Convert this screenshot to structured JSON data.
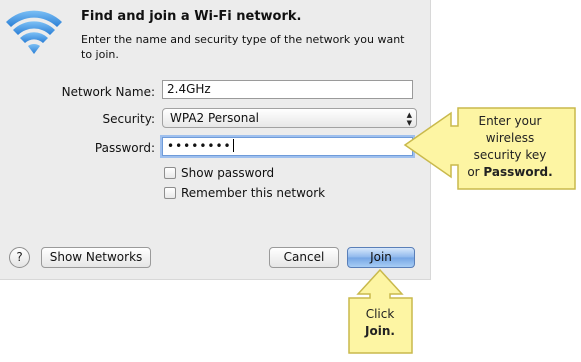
{
  "dialog": {
    "title": "Find and join a Wi-Fi network.",
    "subtitle": "Enter the name and security type of the network you want to join."
  },
  "form": {
    "network_name_label": "Network Name:",
    "network_name_value": "2.4GHz",
    "security_label": "Security:",
    "security_value": "WPA2 Personal",
    "password_label": "Password:",
    "password_masked": "••••••••"
  },
  "options": {
    "show_password_label": "Show password",
    "show_password_checked": false,
    "remember_label": "Remember this network",
    "remember_checked": false
  },
  "buttons": {
    "help": "?",
    "show_networks": "Show Networks",
    "cancel": "Cancel",
    "join": "Join"
  },
  "callouts": {
    "password_hint_line1": "Enter your",
    "password_hint_line2": "wireless",
    "password_hint_line3": "security key",
    "password_hint_line4_prefix": "or ",
    "password_hint_line4_bold": "Password.",
    "join_hint_line1": "Click",
    "join_hint_line2_bold": "Join."
  },
  "colors": {
    "dialog_bg": "#ececec",
    "wifi_blue": "#3a8fe0",
    "callout_fill": "#fdf5a3",
    "callout_stroke": "#c9b94c",
    "primary_button": "#8db7ec"
  }
}
